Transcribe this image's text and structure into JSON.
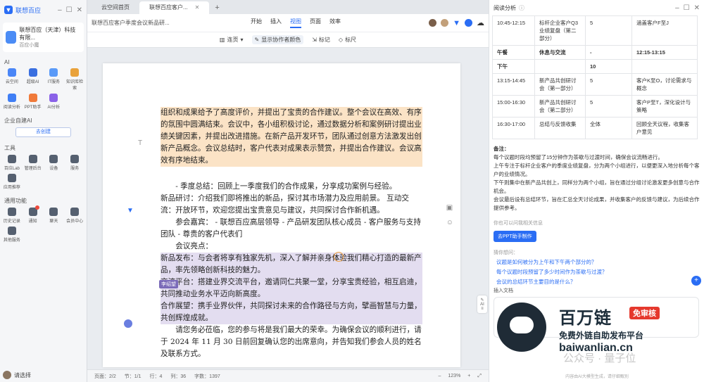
{
  "sidebar": {
    "brand": "联想百应",
    "company_name": "联想百应（天津）科技有限...",
    "company_sub": "百应小魔",
    "ai_label": "AI",
    "ai_tools": [
      "云空间",
      "超级AI",
      "IT服务",
      "知识库检索",
      "阅读分析",
      "PPT助手",
      "AI分析"
    ],
    "enterprise_ai_label": "企业自建AI",
    "create_button": "去创建",
    "tools_label": "工具",
    "tools": [
      "百应Lab",
      "管理后台",
      "设备",
      "服务",
      "应用推荐"
    ],
    "common_label": "通用功能",
    "common": [
      "历史记录",
      "通知",
      "聊天",
      "会员中心",
      "其他服务"
    ],
    "notif_count": "1",
    "user_name": "请选择"
  },
  "doc": {
    "tabs": [
      "云空间首页",
      "联想百应客户..."
    ],
    "title": "联想百应客户季度会议新品研...",
    "menu": [
      "开始",
      "插入",
      "视图",
      "页面",
      "效率"
    ],
    "active_menu": "视图",
    "toolbar2": [
      "连页",
      "显示协作者颜色",
      "标记",
      "标尺"
    ],
    "text": {
      "p1": "组织和成果给予了高度评价，并提出了宝贵的合作建议。整个会议在高效、有序的氛围中圆满结束。会议中，各小组积极讨论，通过数据分析和案例研讨提出业绩关键因素，并提出改进措施。在新产品开发环节，团队通过创意方法激发出创新产品概念。会议总结时，客户代表对成果表示赞赏，并提出合作建议。会议高效有序地结束。",
      "p2": "- 季度总结：回顾上一季度我们的合作成果，分享成功案例与经验。",
      "p3": "新品研讨：介绍我们即将推出的新品，探讨其市场潜力及应用前景。 互动交流：开放环节，欢迎您提出宝贵意见与建议，共同探讨合作新机遇。",
      "p4": "参会嘉宾： - 联想百应高层领导 - 产品研发团队核心成员 - 客户服务与支持团队 - 尊贵的客户代表们",
      "p5": "会议亮点：",
      "p6": "新品发布：与会者将享有独家先机，深入了解并亲身体验我们精心打造的最新产品，率先领略创新科技的魅力。",
      "p7": "交流平台：搭建业界交流平台，邀请同仁共聚一堂，分享宝贵经验，相互启迪，共同推动业务水平迈向新高度。",
      "p8": "合作展望：携手业界伙伴，共同探讨未来的合作路径与方向，擘画智慧与力量，共创辉煌成就。",
      "p9": "请您务必莅临，您的参与将是我们最大的荣幸。为确保会议的顺利进行，请于 2024 年 11 月 30 日前回复确认您的出席意向，并告知我们参会人员的姓名及联系方式。"
    },
    "cursor_tag": "李绍望",
    "status": {
      "page": "页面：2/2",
      "section": "节：1/1",
      "row": "行：4",
      "col": "列：36",
      "words": "字数：1397",
      "zoom": "123%"
    }
  },
  "panel": {
    "title": "阅读分析",
    "schedule": [
      {
        "time": "10:45-12:15",
        "topic": "标杆企业客户Q3业绩复盘（第二部分）",
        "n": "5",
        "note": "涵盖客户F至J",
        "bold": false
      },
      {
        "time": "午餐",
        "topic": "休息与交流",
        "n": "-",
        "note": "12:15-13:15",
        "bold": true
      },
      {
        "time": "下午",
        "topic": "",
        "n": "10",
        "note": "",
        "bold": true
      },
      {
        "time": "13:15-14:45",
        "topic": "新产品共创研讨会（第一部分）",
        "n": "5",
        "note": "客户K至O，讨论需求与概念",
        "bold": false
      },
      {
        "time": "15:00-16:30",
        "topic": "新产品共创研讨会（第二部分）",
        "n": "5",
        "note": "客户P至T，深化设计与策略",
        "bold": false
      },
      {
        "time": "16:30-17:00",
        "topic": "总结与反馈收集",
        "n": "全体",
        "note": "回顾全天议程，收集客户意见",
        "bold": false
      }
    ],
    "notes_title": "备注：",
    "notes": [
      "每个议题时段均预留了15分钟作为茶歇与过渡时间，确保会议流畅进行。",
      "上午专注于标杆企业客户的季度业绩复盘，分为两个小组进行，以便更深入地分析每个客户的业绩情况。",
      "下午则集中在新产品共创上，同样分为两个小组，旨在通过分组讨论激发更多创意与合作机会。",
      "会议最后设有总结环节，旨在汇总全天讨论成果，并收集客户的反馈与建议，为后续合作提供参考。"
    ],
    "hint": "你也可以问我相关信息",
    "ppt_button": "去PPT助手制作",
    "ask_label": "猜你想问：",
    "questions": [
      "议题是如何被分为上午和下午两个部分的？",
      "每个议题时段预留了多少时间作为茶歇与过渡？",
      "会议的总结环节主要目的是什么？"
    ],
    "insert_label": "插入文档",
    "footer": "内容由AI大模型生成，请仔细甄别"
  },
  "watermark": {
    "title": "百万链",
    "tag": "免审核",
    "sub": "免费外链自助发布平台",
    "url": "baiwanlian.cn",
    "gzh": "公众号 · 量子位"
  }
}
